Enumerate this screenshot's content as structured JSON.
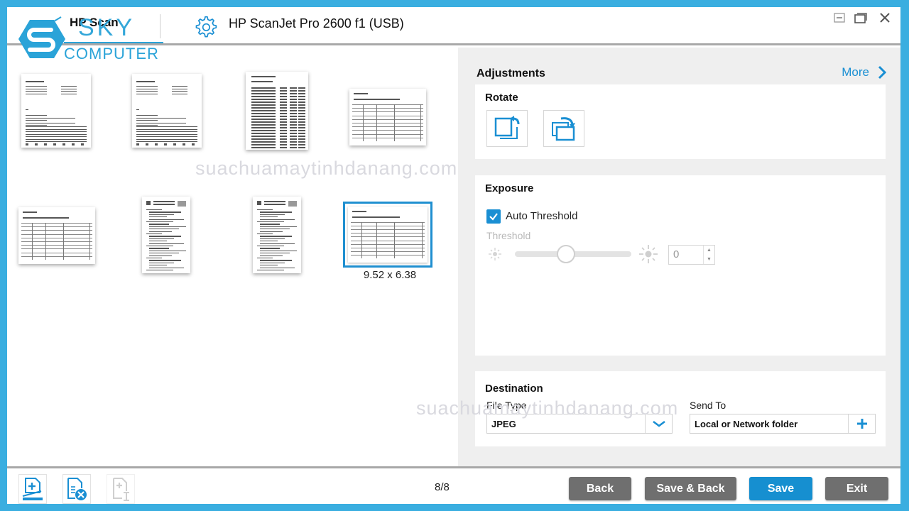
{
  "titlebar": {
    "app_name": "HP Scan",
    "device_name": "HP ScanJet Pro 2600 f1 (USB)",
    "controls": [
      "minimize",
      "maximize",
      "close"
    ]
  },
  "watermark_logo": {
    "brand_top": "SKY",
    "brand_bottom": "COMPUTER",
    "watermark_text": "suachuamaytinhdanang.com"
  },
  "thumbnails": {
    "items": [
      {
        "name": "page-1",
        "kind": "letter-portrait"
      },
      {
        "name": "page-2",
        "kind": "letter-portrait"
      },
      {
        "name": "page-3",
        "kind": "list-portrait"
      },
      {
        "name": "page-4",
        "kind": "table-landscape"
      },
      {
        "name": "page-5",
        "kind": "table-landscape"
      },
      {
        "name": "page-6",
        "kind": "text-portrait"
      },
      {
        "name": "page-7",
        "kind": "text-portrait"
      },
      {
        "name": "page-8",
        "kind": "table-landscape",
        "selected": true
      }
    ],
    "selected_caption": "9.52 x 6.38"
  },
  "adjustments": {
    "title": "Adjustments",
    "more_label": "More",
    "rotate": {
      "title": "Rotate",
      "buttons": [
        {
          "label": "Rotate left",
          "icon": "rotate-left-icon"
        },
        {
          "label": "Rotate right",
          "icon": "rotate-right-icon"
        }
      ]
    },
    "exposure": {
      "title": "Exposure",
      "auto_threshold_label": "Auto Threshold",
      "auto_threshold_checked": true,
      "threshold_label": "Threshold",
      "threshold_value": "0",
      "slider_position_fraction": 0.43
    },
    "destination": {
      "title": "Destination",
      "file_type_label": "File Type",
      "file_type_value": "JPEG",
      "send_to_label": "Send To",
      "send_to_value": "Local or Network folder"
    }
  },
  "bottombar": {
    "tools": [
      {
        "label": "Add pages",
        "icon": "add-page-scan-icon"
      },
      {
        "label": "Delete page",
        "icon": "delete-page-icon"
      },
      {
        "label": "Insert page",
        "icon": "insert-page-icon",
        "disabled": true
      }
    ],
    "page_count": "8/8",
    "buttons": {
      "back": "Back",
      "save_back": "Save & Back",
      "save": "Save",
      "exit": "Exit"
    }
  },
  "colors": {
    "accent": "#168fd0",
    "frame": "#3aaee0",
    "button_gray": "#6f6f6f"
  }
}
